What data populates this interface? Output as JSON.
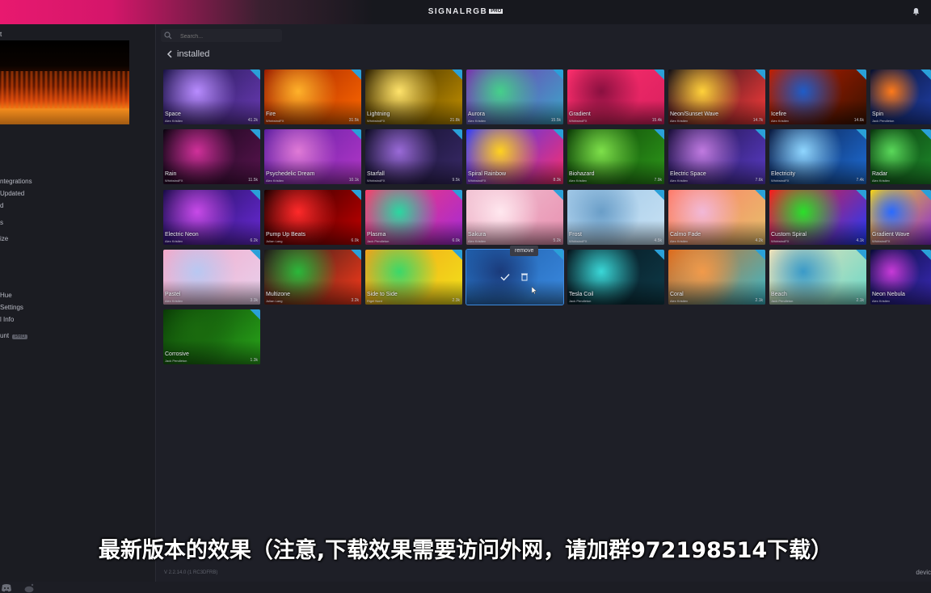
{
  "app": {
    "brand": "SIGNALRGB",
    "brand_tag": "PRO"
  },
  "sidebar": {
    "title": "t",
    "items": [
      {
        "label": "ntegrations"
      },
      {
        "label": "Updated"
      },
      {
        "label": "d"
      },
      {
        "label": "s"
      },
      {
        "label": "ize"
      },
      {
        "label": "Hue"
      },
      {
        "label": "Settings"
      },
      {
        "label": "l Info"
      },
      {
        "label": "unt",
        "badge": "PRO"
      }
    ]
  },
  "main": {
    "search_placeholder": "Search...",
    "heading": "installed",
    "remove_tooltip": "remove",
    "version": "V 2.2.14.0 (1 RC3DFRB)",
    "devices_label": "devic"
  },
  "effects": [
    {
      "name": "Space",
      "author": "Alex Kristiev",
      "downloads": "41.2k",
      "colors": [
        "#1b1446",
        "#6a3bb5",
        "#b88cff"
      ]
    },
    {
      "name": "Fire",
      "author": "WhirlwindFX",
      "downloads": "31.5k",
      "colors": [
        "#9a1c00",
        "#ff6a00",
        "#ffb22a"
      ]
    },
    {
      "name": "Lightning",
      "author": "WhirlwindFX",
      "downloads": "21.8k",
      "colors": [
        "#2a1d00",
        "#c79400",
        "#ffe36b"
      ]
    },
    {
      "name": "Aurora",
      "author": "Alex Kristiev",
      "downloads": "15.5k",
      "colors": [
        "#7b2fb0",
        "#3aa9c9",
        "#45d08a"
      ]
    },
    {
      "name": "Gradient",
      "author": "WhirlwindFX",
      "downloads": "15.4k",
      "colors": [
        "#ff2f6d",
        "#d9205f",
        "#8a1040"
      ]
    },
    {
      "name": "Neon/Sunset Wave",
      "author": "Alex Kristiev",
      "downloads": "14.7k",
      "colors": [
        "#111016",
        "#ff3c3c",
        "#ffd23a"
      ]
    },
    {
      "name": "Icefire",
      "author": "Alex Kristiev",
      "downloads": "14.6k",
      "colors": [
        "#c21f00",
        "#3a1200",
        "#1f5cc8"
      ]
    },
    {
      "name": "Spin",
      "author": "Jack Pendleton",
      "downloads": "",
      "colors": [
        "#0a1230",
        "#1f3fa8",
        "#ff7a1a"
      ]
    },
    {
      "name": "Rain",
      "author": "WhirlwindFX",
      "downloads": "11.5k",
      "colors": [
        "#0c0410",
        "#5a1450",
        "#d0309a"
      ]
    },
    {
      "name": "Psychedelic Dream",
      "author": "Alex Kristiev",
      "downloads": "10.1k",
      "colors": [
        "#5a1ea0",
        "#b437c8",
        "#e07ad6"
      ]
    },
    {
      "name": "Starfall",
      "author": "WhirlwindFX",
      "downloads": "9.5k",
      "colors": [
        "#0d0c22",
        "#3a2a6a",
        "#9a6ad8"
      ]
    },
    {
      "name": "Spiral Rainbow",
      "author": "WhirlwindFX",
      "downloads": "8.3k",
      "colors": [
        "#2f3cff",
        "#ff2e6c",
        "#ffd21f"
      ]
    },
    {
      "name": "Biohazard",
      "author": "Alex Kristiev",
      "downloads": "7.9k",
      "colors": [
        "#0b3a06",
        "#2e9a1a",
        "#7ee04a"
      ]
    },
    {
      "name": "Electric Space",
      "author": "Alex Kristiev",
      "downloads": "7.6k",
      "colors": [
        "#1a0e38",
        "#5a3cc8",
        "#c07ae0"
      ]
    },
    {
      "name": "Electricity",
      "author": "WhirlwindFX",
      "downloads": "7.4k",
      "colors": [
        "#0a1a40",
        "#1e6ed8",
        "#8fd6ff"
      ]
    },
    {
      "name": "Radar",
      "author": "Alex Kristiev",
      "downloads": "",
      "colors": [
        "#0b3a10",
        "#1e8a2a",
        "#5ad85a"
      ]
    },
    {
      "name": "Electric Neon",
      "author": "Alex Kristiev",
      "downloads": "6.2k",
      "colors": [
        "#1a0c4a",
        "#6a2ad8",
        "#c84ae8"
      ]
    },
    {
      "name": "Pump Up Beats",
      "author": "Julian Lang",
      "downloads": "6.0k",
      "colors": [
        "#1a0000",
        "#c80000",
        "#ff2a2a"
      ]
    },
    {
      "name": "Plasma",
      "author": "Jack Pendleton",
      "downloads": "6.0k",
      "colors": [
        "#ff3c6a",
        "#a32ad8",
        "#2ad8a0"
      ]
    },
    {
      "name": "Sakura",
      "author": "Alex Kristiev",
      "downloads": "5.2k",
      "colors": [
        "#f2c4d4",
        "#e890b0",
        "#ffe8ef"
      ]
    },
    {
      "name": "Frost",
      "author": "WhirlwindFX",
      "downloads": "4.5k",
      "colors": [
        "#9ec6e6",
        "#c8e2f4",
        "#6a9ec8"
      ]
    },
    {
      "name": "Calmo Fade",
      "author": "Alex Kristiev",
      "downloads": "4.2k",
      "colors": [
        "#ff7a6a",
        "#e6c06a",
        "#f2b8d8"
      ]
    },
    {
      "name": "Custom Spiral",
      "author": "WhirlwindFX",
      "downloads": "4.1k",
      "colors": [
        "#ff1a1a",
        "#1e3aff",
        "#2ae02a"
      ]
    },
    {
      "name": "Gradient Wave",
      "author": "WhirlwindFX",
      "downloads": "",
      "colors": [
        "#f2d21a",
        "#8a2ad8",
        "#2a6aff"
      ]
    },
    {
      "name": "Pastel",
      "author": "Alex Kristiev",
      "downloads": "3.3k",
      "colors": [
        "#f4a8c8",
        "#e8d0ec",
        "#b8c8f2"
      ]
    },
    {
      "name": "Multizone",
      "author": "Julian Lang",
      "downloads": "3.2k",
      "colors": [
        "#1a1a1a",
        "#ff3a1a",
        "#2ab83a"
      ]
    },
    {
      "name": "Side to Side",
      "author": "Rigel Nord",
      "downloads": "2.3k",
      "colors": [
        "#f2a01a",
        "#f2e21a",
        "#3ad86a"
      ]
    },
    {
      "name": "",
      "author": "",
      "downloads": "",
      "colors": [
        "#1e5ca8",
        "#3a8ae0",
        "#1a3a7a"
      ]
    },
    {
      "name": "Tesla Coil",
      "author": "Jack Pendleton",
      "downloads": "",
      "colors": [
        "#06141c",
        "#0e3a48",
        "#3ad8d8"
      ]
    },
    {
      "name": "Coral",
      "author": "Alex Kristiev",
      "downloads": "2.1k",
      "colors": [
        "#e06a1a",
        "#3ab8c8",
        "#f29a4a"
      ]
    },
    {
      "name": "Beach",
      "author": "Jack Pendleton",
      "downloads": "2.1k",
      "colors": [
        "#f2e2b8",
        "#6ad8c8",
        "#3a9ac8"
      ]
    },
    {
      "name": "Neon Nebula",
      "author": "Alex Kristiev",
      "downloads": "",
      "colors": [
        "#0a0c3a",
        "#3a2ab8",
        "#c83ad8"
      ]
    },
    {
      "name": "Corrosive",
      "author": "Jack Pendleton",
      "downloads": "1.3k",
      "colors": [
        "#0a3a06",
        "#2aa81a",
        "#1a6a0e"
      ]
    }
  ],
  "subtitle": "最新版本的效果（注意,下载效果需要访问外网，请加群972198514下载）"
}
